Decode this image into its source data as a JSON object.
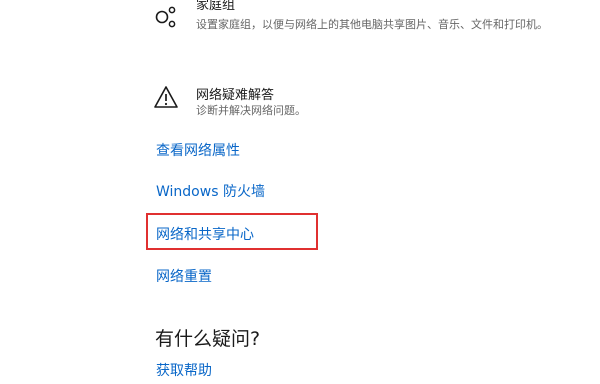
{
  "homegroup": {
    "title": "家庭组",
    "description": "设置家庭组，以便与网络上的其他电脑共享图片、音乐、文件和打印机。",
    "icon": "homegroup-icon"
  },
  "troubleshoot": {
    "title": "网络疑难解答",
    "description": "诊断并解决网络问题。",
    "icon": "warning-icon"
  },
  "links": {
    "properties": "查看网络属性",
    "firewall": "Windows 防火墙",
    "sharing_center": "网络和共享中心",
    "reset": "网络重置"
  },
  "help": {
    "heading": "有什么疑问?",
    "get_help": "获取帮助"
  },
  "colors": {
    "link": "#0a67c8",
    "highlight": "#e03030"
  }
}
